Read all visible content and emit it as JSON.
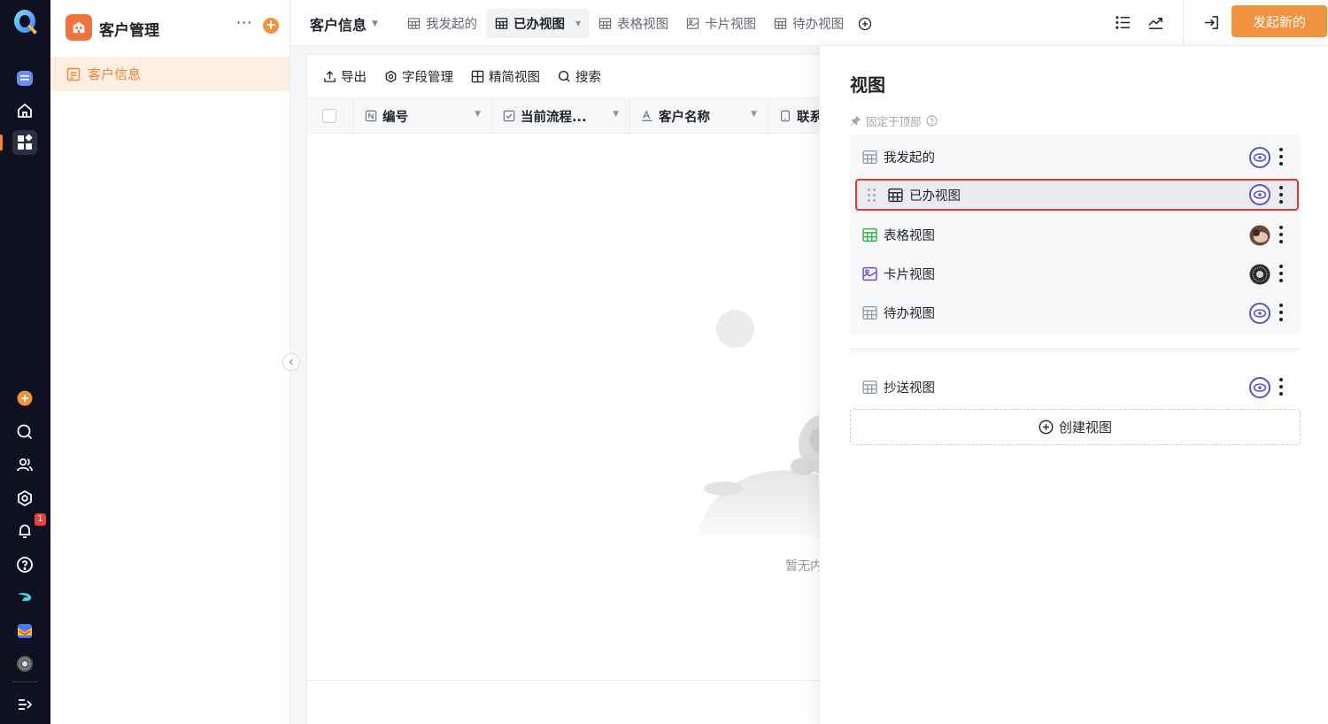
{
  "rail": {
    "notification_count": "1"
  },
  "app": {
    "title": "客户管理",
    "nav_active": "客户信息"
  },
  "header": {
    "form_title": "客户信息",
    "tabs": [
      {
        "label": "我发起的",
        "icon": "table-icon",
        "active": false
      },
      {
        "label": "已办视图",
        "icon": "table-icon",
        "active": true
      },
      {
        "label": "表格视图",
        "icon": "table-icon",
        "active": false
      },
      {
        "label": "卡片视图",
        "icon": "card-icon",
        "active": false
      },
      {
        "label": "待办视图",
        "icon": "table-icon",
        "active": false
      }
    ],
    "primary_button": "发起新的"
  },
  "toolbar": {
    "export": "导出",
    "fields": "字段管理",
    "compact": "精简视图",
    "search": "搜索"
  },
  "table": {
    "columns": [
      {
        "label": "编号",
        "icon": "number-field-icon"
      },
      {
        "label": "当前流程...",
        "icon": "checkbox-field-icon"
      },
      {
        "label": "客户名称",
        "icon": "text-field-icon"
      },
      {
        "label": "联系",
        "icon": "phone-field-icon"
      }
    ],
    "empty_text": "暂无内"
  },
  "panel": {
    "title": "视图",
    "pinned_label": "固定于顶部",
    "pinned_views": [
      {
        "label": "我发起的",
        "icon": "table-icon",
        "visibility": "eye-icon",
        "selected": false
      },
      {
        "label": "已办视图",
        "icon": "table-icon",
        "visibility": "eye-icon",
        "selected": true
      },
      {
        "label": "表格视图",
        "icon": "table-green-icon",
        "visibility": "avatar",
        "selected": false
      },
      {
        "label": "卡片视图",
        "icon": "card-purple-icon",
        "visibility": "avatar",
        "selected": false
      },
      {
        "label": "待办视图",
        "icon": "table-icon",
        "visibility": "eye-icon",
        "selected": false
      }
    ],
    "other_views": [
      {
        "label": "抄送视图",
        "icon": "table-icon",
        "visibility": "eye-icon"
      }
    ],
    "create_label": "创建视图"
  },
  "colors": {
    "accent": "#f0933e",
    "rail_bg": "#0f1021",
    "selection_border": "#e0372b",
    "eye_purple": "#5b4fd6"
  }
}
